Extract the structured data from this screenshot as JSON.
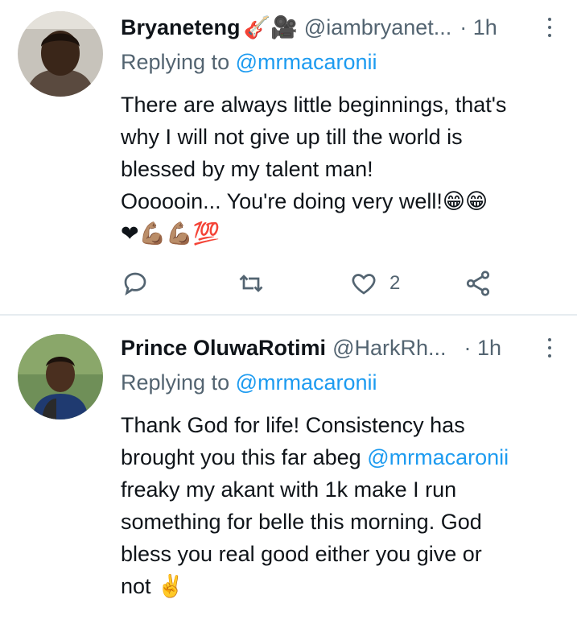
{
  "tweets": [
    {
      "name": "Bryaneteng",
      "name_emoji": "🎸🎥",
      "handle": "@iambryanet...",
      "time": "· 1h",
      "replying_prefix": "Replying to",
      "replying_to": "@mrmacaronii",
      "text_lines": [
        "There are always little beginnings, that's",
        "why I will not give up till the world is",
        "blessed by my talent man!",
        "Oooooin... You're doing very well!😁😁",
        "❤💪🏽💪🏽💯"
      ],
      "actions": {
        "reply_icon": "reply-icon",
        "retweet_icon": "retweet-icon",
        "like_icon": "heart-icon",
        "like_count": "2",
        "share_icon": "share-icon"
      }
    },
    {
      "name": "Prince OluwaRotimi",
      "handle": "@HarkRh...",
      "time": "· 1h",
      "replying_prefix": "Replying to",
      "replying_to": "@mrmacaronii",
      "text_parts": {
        "line1": "Thank God for life! Consistency has",
        "line2_prefix": "brought you this far abeg ",
        "line2_mention": "@mrmacaronii",
        "line3": "freaky my akant with 1k make I run",
        "line4": "something for belle this morning. God",
        "line5": "bless you real good either you give or",
        "line6": "not ✌️"
      }
    }
  ],
  "colors": {
    "text": "#0f1419",
    "secondary": "#536471",
    "link": "#1d9bf0",
    "divider": "#e6ecf0"
  }
}
